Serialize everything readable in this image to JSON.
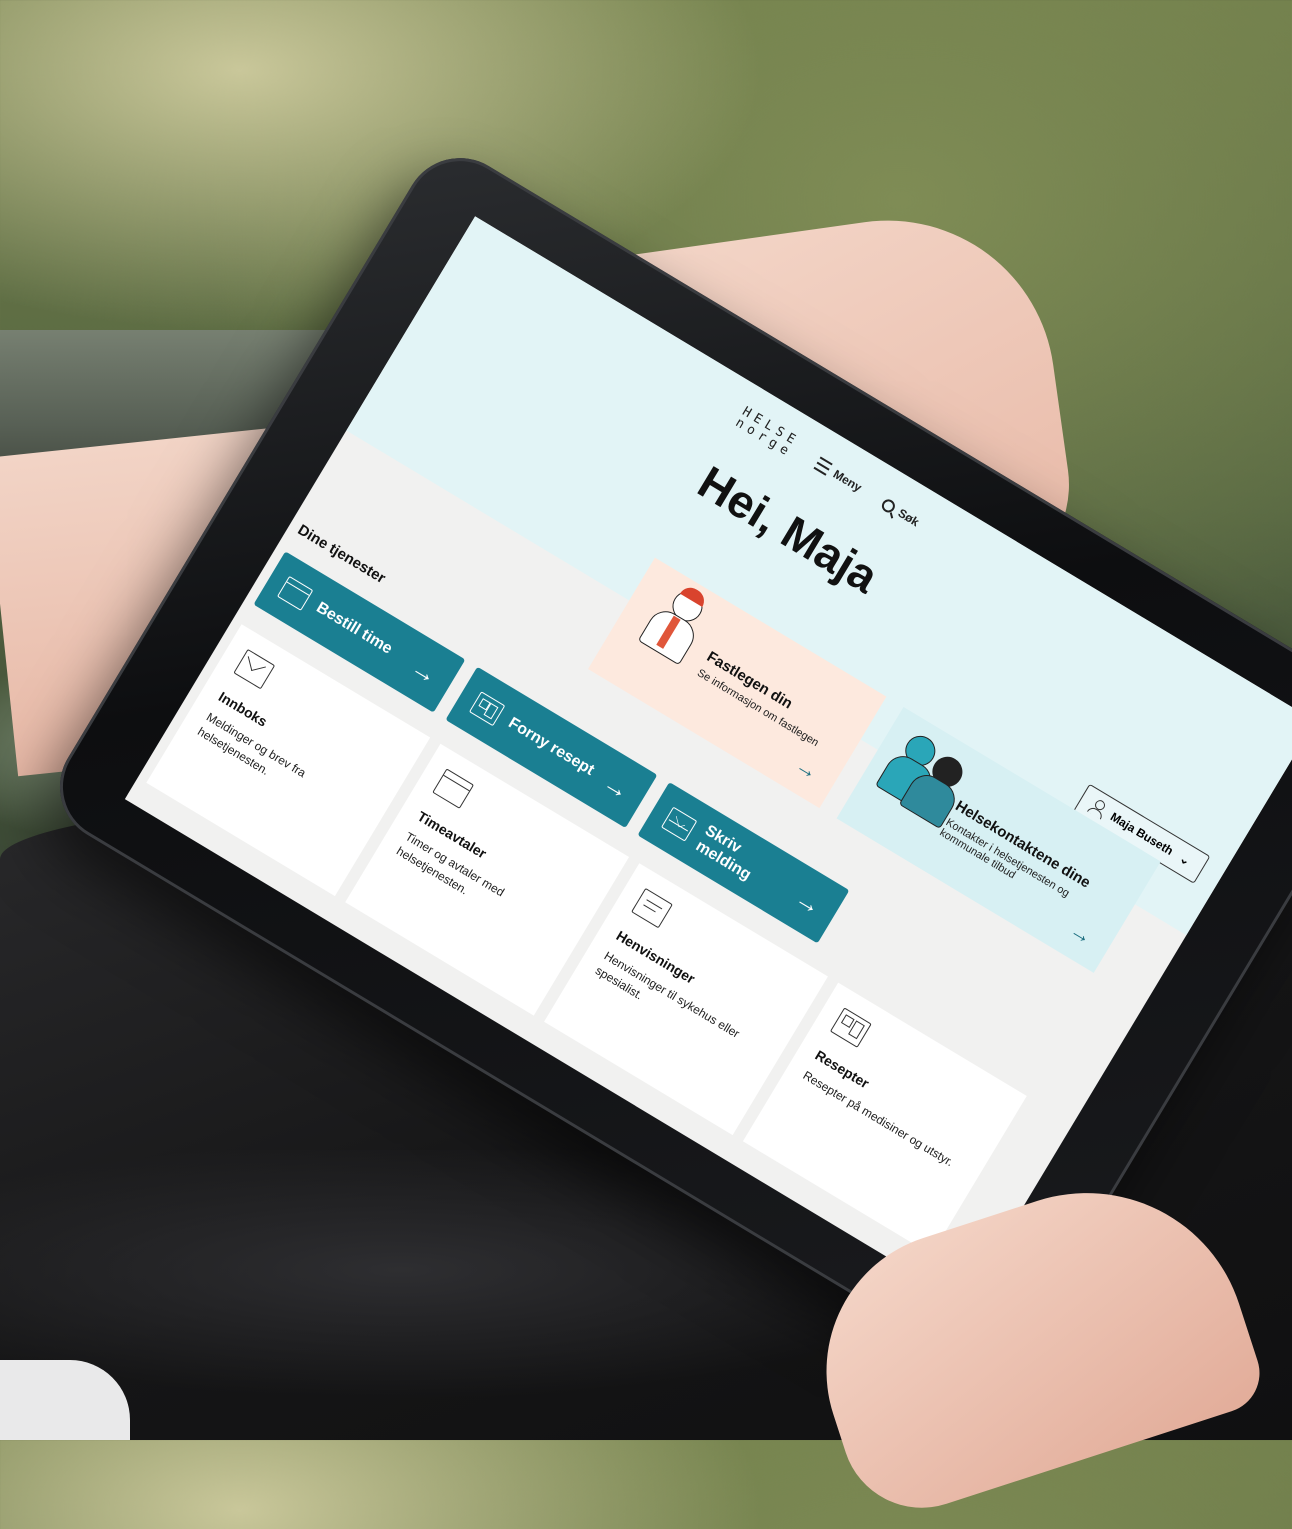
{
  "logo": {
    "line1": "HELSE",
    "line2": "norge"
  },
  "header": {
    "menu_label": "Meny",
    "search_label": "Søk"
  },
  "greeting": "Hei, Maja",
  "user": {
    "name": "Maja Buseth"
  },
  "cards": [
    {
      "title": "Fastlegen din",
      "subtitle": "Se informasjon om fastlegen"
    },
    {
      "title": "Helsekontaktene dine",
      "subtitle": "Kontakter i helsetjenesten og kommunale tilbud"
    }
  ],
  "services": {
    "title": "Dine tjenester",
    "actions": [
      {
        "label": "Bestill time",
        "icon": "calendar-icon"
      },
      {
        "label": "Forny resept",
        "icon": "prescription-icon"
      },
      {
        "label": "Skriv melding",
        "icon": "envelope-icon"
      }
    ],
    "tiles": [
      {
        "title": "Innboks",
        "desc": "Meldinger og brev fra helsetjenesten.",
        "icon": "envelope-icon"
      },
      {
        "title": "Timeavtaler",
        "desc": "Timer og avtaler med helsetjenesten.",
        "icon": "calendar-icon"
      },
      {
        "title": "Henvisninger",
        "desc": "Henvisninger til sykehus eller spesialist.",
        "icon": "document-icon"
      },
      {
        "title": "Resepter",
        "desc": "Resepter på medisiner og utstyr.",
        "icon": "prescription-icon"
      }
    ]
  },
  "colors": {
    "accent": "#1a7f92",
    "hero_bg": "#e2f4f6",
    "doctor_card": "#fde9de",
    "contacts_card": "#d7f0f3",
    "page_bg": "#f1f1f0"
  }
}
